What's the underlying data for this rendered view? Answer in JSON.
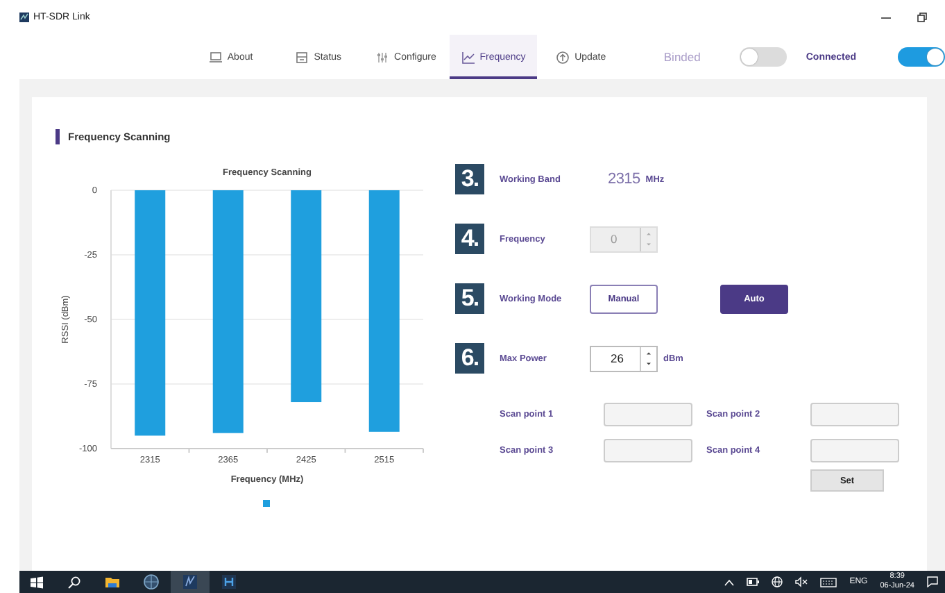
{
  "window": {
    "title": "HT-SDR Link"
  },
  "tabs": [
    {
      "label": "About",
      "selected": false
    },
    {
      "label": "Status",
      "selected": false
    },
    {
      "label": "Configure",
      "selected": false
    },
    {
      "label": "Frequency",
      "selected": true
    },
    {
      "label": "Update",
      "selected": false
    }
  ],
  "links": [
    {
      "label": "Binded",
      "on": false
    },
    {
      "label": "Connected",
      "on": true
    }
  ],
  "section": {
    "title": "Frequency Scanning"
  },
  "chart_data": {
    "type": "bar",
    "title": "Frequency Scanning",
    "xlabel": "Frequency (MHz)",
    "ylabel": "RSSI (dBm)",
    "categories": [
      "2315",
      "2365",
      "2425",
      "2515"
    ],
    "series": [
      {
        "color": "#1f9fde",
        "values": [
          -95,
          -94,
          -82,
          -93.5
        ]
      }
    ],
    "ylim": [
      -100,
      0
    ],
    "yticks": [
      0,
      -25,
      -50,
      -75,
      -100
    ],
    "grid": true
  },
  "settings": [
    {
      "number": "3.",
      "label": "Working Band",
      "kind": "reading",
      "value": "2315",
      "unit": "MHz"
    },
    {
      "number": "4.",
      "label": "Frequency",
      "kind": "spinner",
      "value": "0",
      "disabled": true
    },
    {
      "number": "5.",
      "label": "Working Mode",
      "kind": "choice",
      "options": [
        {
          "label": "Manual",
          "selected": false
        },
        {
          "label": "Auto",
          "selected": true
        }
      ]
    },
    {
      "number": "6.",
      "label": "Max Power",
      "kind": "spinner",
      "value": "26",
      "unit": "dBm",
      "disabled": false
    }
  ],
  "scan_points": [
    {
      "label": "Scan point 1"
    },
    {
      "label": "Scan point 2"
    },
    {
      "label": "Scan point 3"
    },
    {
      "label": "Scan point 4"
    }
  ],
  "set_button": "Set",
  "taskbar": {
    "apps": [
      {
        "selected": false
      },
      {
        "selected": false
      },
      {
        "selected": true
      },
      {
        "selected": false
      }
    ],
    "language": "ENG",
    "time": "8:39",
    "date": "06-Jun-24"
  }
}
